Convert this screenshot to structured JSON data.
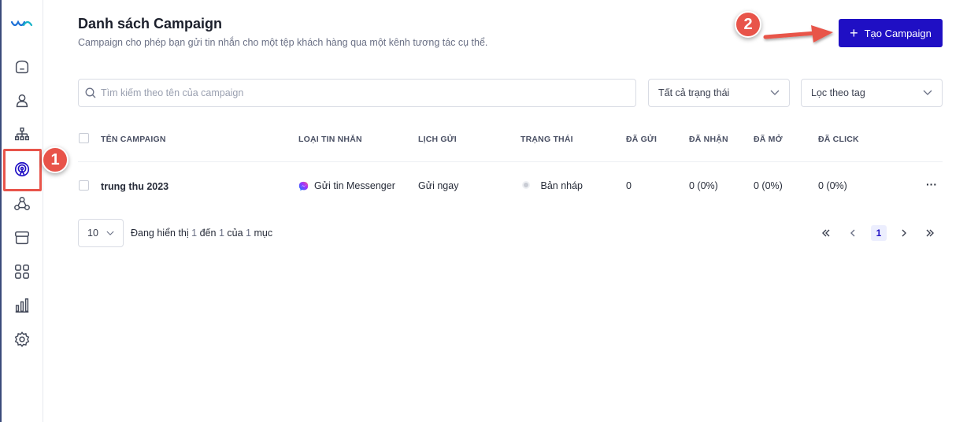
{
  "header": {
    "title": "Danh sách Campaign",
    "subtitle": "Campaign cho phép bạn gửi tin nhắn cho một tệp khách hàng qua một kênh tương tác cụ thể.",
    "create_label": "Tạo Campaign"
  },
  "annotations": {
    "step1": "1",
    "step2": "2"
  },
  "filters": {
    "search_placeholder": "Tìm kiếm theo tên của campaign",
    "status_select": "Tất cả trạng thái",
    "tag_select": "Lọc theo tag"
  },
  "table": {
    "columns": [
      "TÊN CAMPAIGN",
      "LOẠI TIN NHẮN",
      "LỊCH GỬI",
      "TRẠNG THÁI",
      "ĐÃ GỬI",
      "ĐÃ NHẬN",
      "ĐÃ MỞ",
      "ĐÃ CLICK"
    ],
    "rows": [
      {
        "name": "trung thu 2023",
        "type": "Gửi tin Messenger",
        "schedule": "Gửi ngay",
        "status": "Bản nháp",
        "sent": "0",
        "received": "0 (0%)",
        "opened": "0 (0%)",
        "clicked": "0 (0%)",
        "more": "···"
      }
    ]
  },
  "pagination": {
    "page_size": "10",
    "showing_prefix": "Đang hiển thị",
    "from": "1",
    "to_word": "đến",
    "to": "1",
    "of_word": "của",
    "total": "1",
    "suffix": "mục",
    "current_page": "1"
  },
  "colors": {
    "accent": "#1f0fc4",
    "annotation": "#e8544a"
  },
  "icons": {
    "sidebar": [
      "home-icon",
      "user-icon",
      "org-chart-icon",
      "campaign-icon",
      "segments-icon",
      "archive-icon",
      "apps-grid-icon",
      "reports-icon",
      "settings-icon"
    ]
  }
}
